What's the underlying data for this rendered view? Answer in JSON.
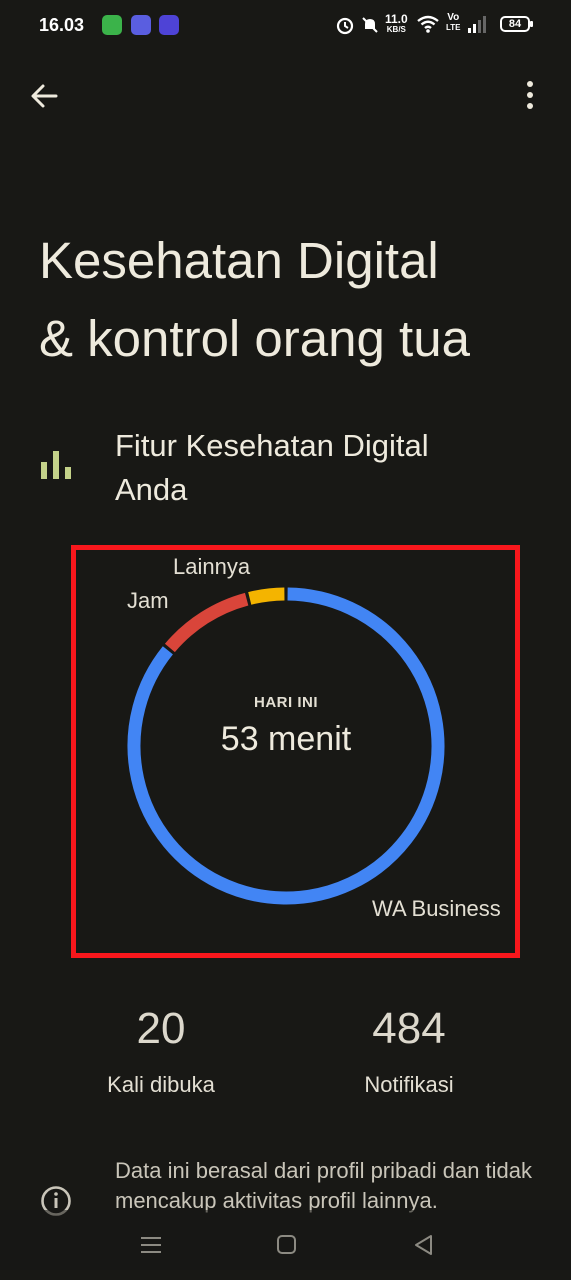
{
  "status_bar": {
    "time": "16.03",
    "network_speed_value": "11.0",
    "network_speed_unit": "KB/S",
    "volte_top": "Vo",
    "volte_bottom": "LTE",
    "battery": "84"
  },
  "header": {
    "title_line1": "Kesehatan Digital",
    "title_line2": "& kontrol orang tua"
  },
  "section": {
    "title_line1": "Fitur Kesehatan Digital",
    "title_line2": "Anda"
  },
  "usage_chart": {
    "center_caption": "HARI INI",
    "center_value": "53 menit"
  },
  "chart_data": {
    "type": "pie",
    "style": "donut",
    "slices": [
      {
        "label": "WA Business",
        "fraction": 0.86,
        "color": "#4285f4"
      },
      {
        "label": "Jam",
        "fraction": 0.1,
        "color": "#d9453a"
      },
      {
        "label": "Lainnya",
        "fraction": 0.04,
        "color": "#f4b400"
      }
    ],
    "center_caption": "HARI INI",
    "center_value": "53 menit"
  },
  "stats": {
    "opened_count": "20",
    "opened_label": "Kali dibuka",
    "notifications_count": "484",
    "notifications_label": "Notifikasi"
  },
  "info": {
    "text": "Data ini berasal dari profil pribadi dan tidak mencakup aktivitas profil lainnya."
  },
  "colors": {
    "background": "#181815",
    "accent_green": "#c4d289",
    "highlight_red": "#f8171c"
  },
  "icons": {
    "back": "arrow-back-icon",
    "menu": "more-vert-icon",
    "section": "bar-chart-icon",
    "info": "info-icon"
  }
}
